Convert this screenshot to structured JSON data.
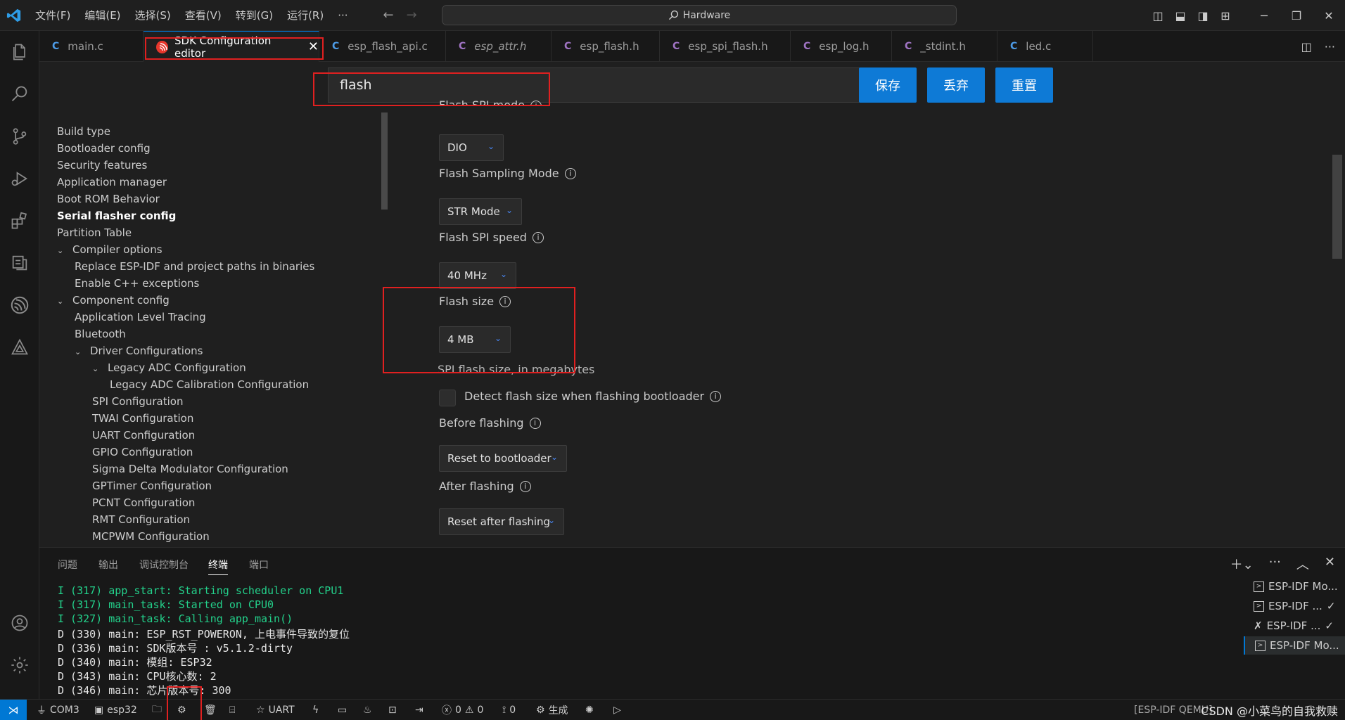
{
  "window": {
    "search_label": "Hardware",
    "menu": [
      "文件(F)",
      "编辑(E)",
      "选择(S)",
      "查看(V)",
      "转到(G)",
      "运行(R)",
      "···"
    ]
  },
  "colors": {
    "accent": "#0078d4",
    "button": "#0e7ad6",
    "highlight_box": "#e02020",
    "terminal_green": "#23d18b"
  },
  "tabs": [
    {
      "label": "main.c",
      "lang": "C"
    },
    {
      "label": "SDK Configuration editor",
      "lang": "esp"
    },
    {
      "label": "esp_flash_api.c",
      "lang": "C"
    },
    {
      "label": "esp_attr.h",
      "lang": "C"
    },
    {
      "label": "esp_flash.h",
      "lang": "C"
    },
    {
      "label": "esp_spi_flash.h",
      "lang": "C"
    },
    {
      "label": "esp_log.h",
      "lang": "C"
    },
    {
      "label": "_stdint.h",
      "lang": "C"
    },
    {
      "label": "led.c",
      "lang": "C"
    }
  ],
  "editor": {
    "search_value": "flash",
    "buttons": {
      "save": "保存",
      "discard": "丢弃",
      "reset": "重置"
    },
    "tree": [
      "Build type",
      "Bootloader config",
      "Security features",
      "Application manager",
      "Boot ROM Behavior",
      "Serial flasher config",
      "Partition Table",
      "Compiler options",
      "Replace ESP-IDF and project paths in binaries",
      "Enable C++ exceptions",
      "Component config",
      "Application Level Tracing",
      "Bluetooth",
      "Driver Configurations",
      "Legacy ADC Configuration",
      "Legacy ADC Calibration Configuration",
      "SPI Configuration",
      "TWAI Configuration",
      "UART Configuration",
      "GPIO Configuration",
      "Sigma Delta Modulator Configuration",
      "GPTimer Configuration",
      "PCNT Configuration",
      "RMT Configuration",
      "MCPWM Configuration"
    ],
    "settings": {
      "spi_mode_label": "Flash SPI mode",
      "spi_mode_value": "DIO",
      "sampling_label": "Flash Sampling Mode",
      "sampling_value": "STR Mode",
      "speed_label": "Flash SPI speed",
      "speed_value": "40 MHz",
      "size_label": "Flash size",
      "size_value": "4 MB",
      "size_desc": "SPI flash size, in megabytes",
      "detect_label": "Detect flash size when flashing bootloader",
      "before_label": "Before flashing",
      "before_value": "Reset to bootloader",
      "after_label": "After flashing",
      "after_value": "Reset after flashing"
    }
  },
  "panel": {
    "tabs": [
      "问题",
      "输出",
      "调试控制台",
      "终端",
      "端口"
    ],
    "terminal_lines": [
      {
        "text": "I (317) app_start: Starting scheduler on CPU1",
        "color": "green"
      },
      {
        "text": "I (317) main_task: Started on CPU0",
        "color": "green"
      },
      {
        "text": "I (327) main_task: Calling app_main()",
        "color": "green"
      },
      {
        "text": "D (330) main: ESP_RST_POWERON, 上电事件导致的复位",
        "color": "white"
      },
      {
        "text": "D (336) main: SDK版本号 :  v5.1.2-dirty",
        "color": "white"
      },
      {
        "text": "D (340) main: 模组: ESP32",
        "color": "white"
      },
      {
        "text": "D (343) main: CPU核心数: 2",
        "color": "white"
      },
      {
        "text": "D (346) main: 芯片版本号: 300",
        "color": "white"
      }
    ],
    "terminals": [
      "ESP-IDF Mo...",
      "ESP-IDF ...",
      "ESP-IDF ...",
      "ESP-IDF Mo..."
    ]
  },
  "statusbar": {
    "port": "COM3",
    "target": "esp32",
    "uart": "UART",
    "errors": "0",
    "warnings": "0",
    "ports_count": "0",
    "build": "生成",
    "right_text": "[ESP-IDF QEMU]",
    "watermark": "CSDN @小菜鸟的自我救赎"
  }
}
